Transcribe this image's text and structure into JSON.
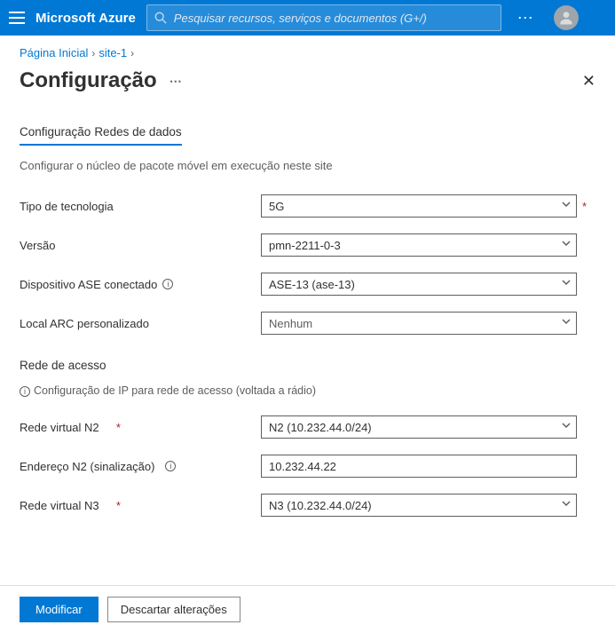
{
  "topbar": {
    "brand": "Microsoft Azure",
    "search_placeholder": "Pesquisar recursos, serviços e documentos (G+/)"
  },
  "breadcrumb": {
    "item1": "Página Inicial",
    "item2": "site-1"
  },
  "page": {
    "title": "Configuração",
    "tab1": "Configuração",
    "tab2": "Redes de dados",
    "description": "Configurar o núcleo de pacote móvel em execução neste site"
  },
  "fields": {
    "tech_label": "Tipo de tecnologia",
    "tech_value": "5G",
    "version_label": "Versão",
    "version_value": "pmn-2211-0-3",
    "ase_label": "Dispositivo ASE conectado",
    "ase_value": "ASE-13 (ase-13)",
    "arc_label": "Local ARC personalizado",
    "arc_value": "Nenhum"
  },
  "access": {
    "heading": "Rede de acesso",
    "subdesc": "Configuração de IP para rede de acesso (voltada a rádio)",
    "n2net_label": "Rede virtual N2",
    "n2net_value": "N2 (10.232.44.0/24)",
    "n2addr_label": "Endereço N2 (sinalização)",
    "n2addr_value": "10.232.44.22",
    "n3net_label": "Rede virtual N3",
    "n3net_value": "N3 (10.232.44.0/24)"
  },
  "footer": {
    "modify": "Modificar",
    "discard": "Descartar alterações"
  }
}
